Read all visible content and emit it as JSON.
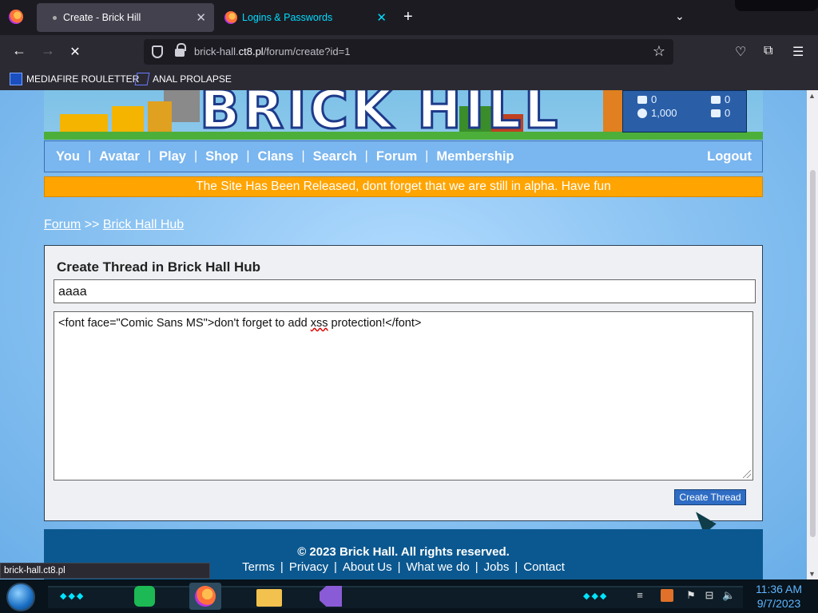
{
  "browser": {
    "tabs": [
      {
        "label": "Create - Brick Hill",
        "active": true
      },
      {
        "label": "Logins & Passwords",
        "active": false
      }
    ],
    "url_host": "brick-hall.",
    "url_domain": "ct8.pl",
    "url_path": "/forum/create?id=1",
    "bookmarks": [
      "MEDIAFIRE ROULETTER",
      "ANAL PROLAPSE"
    ],
    "status_url": "brick-hall.ct8.pl",
    "accent_color": "#00ddff"
  },
  "header": {
    "logo_text": "BRICK HILL",
    "stats": {
      "bucks": "0",
      "bits": "1,000",
      "messages": "0",
      "friends": "0"
    }
  },
  "nav": {
    "items": [
      "You",
      "Avatar",
      "Play",
      "Shop",
      "Clans",
      "Search",
      "Forum",
      "Membership"
    ],
    "logout": "Logout"
  },
  "notice": "The Site Has Been Released, dont forget that we are still in alpha. Have fun",
  "breadcrumb": {
    "root": "Forum",
    "sep": ">>",
    "current": "Brick Hall Hub"
  },
  "form": {
    "heading": "Create Thread in Brick Hall Hub",
    "title_value": "aaaa",
    "body_prefix": "<font face=\"Comic Sans MS\">don't forget to add ",
    "body_misspelled": "xss",
    "body_suffix": " protection!</font>",
    "submit_label": "Create Thread"
  },
  "footer": {
    "copyright": "© 2023 Brick Hall. All rights reserved.",
    "links": [
      "Terms",
      "Privacy",
      "About Us",
      "What we do",
      "Jobs",
      "Contact"
    ]
  },
  "taskbar": {
    "time": "11:36 AM",
    "date": "9/7/2023"
  }
}
